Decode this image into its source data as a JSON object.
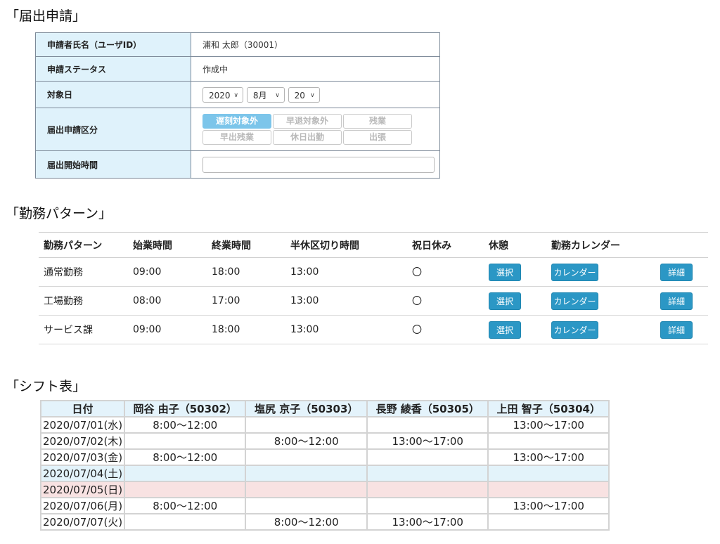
{
  "sections": {
    "form_title": "「届出申請」",
    "pattern_title": "「勤務パターン」",
    "shift_title": "「シフト表」"
  },
  "form": {
    "rows": [
      {
        "label": "申請者氏名（ユーザID）",
        "value": "浦和 太郎（30001）"
      },
      {
        "label": "申請ステータス",
        "value": "作成中"
      },
      {
        "label": "対象日"
      },
      {
        "label": "届出申請区分"
      },
      {
        "label": "届出開始時間"
      }
    ],
    "date": {
      "year": "2020",
      "month": "8月",
      "day": "20"
    },
    "category_buttons": [
      "遅刻対象外",
      "早退対象外",
      "残業",
      "早出残業",
      "休日出勤",
      "出張"
    ],
    "active_category_index": 0,
    "start_time_value": ""
  },
  "pattern": {
    "headers": [
      "勤務パターン",
      "始業時間",
      "終業時間",
      "半休区切り時間",
      "祝日休み",
      "休憩",
      "勤務カレンダー",
      ""
    ],
    "rows": [
      {
        "name": "通常勤務",
        "start": "09:00",
        "end": "18:00",
        "half": "13:00",
        "holiday": "〇"
      },
      {
        "name": "工場勤務",
        "start": "08:00",
        "end": "17:00",
        "half": "13:00",
        "holiday": "〇"
      },
      {
        "name": "サービス課",
        "start": "09:00",
        "end": "18:00",
        "half": "13:00",
        "holiday": "〇"
      }
    ],
    "select_label": "選択",
    "calendar_label": "カレンダー",
    "detail_label": "詳細"
  },
  "shift": {
    "headers": [
      "日付",
      "岡谷 由子（50302）",
      "塩尻 京子（50303）",
      "長野 綾香（50305）",
      "上田 智子（50304）"
    ],
    "rows": [
      {
        "date": "2020/07/01(水)",
        "day_type": "weekday",
        "cells": [
          "8:00～12:00",
          "",
          "",
          "13:00～17:00"
        ]
      },
      {
        "date": "2020/07/02(木)",
        "day_type": "weekday",
        "cells": [
          "",
          "8:00～12:00",
          "13:00～17:00",
          ""
        ]
      },
      {
        "date": "2020/07/03(金)",
        "day_type": "weekday",
        "cells": [
          "8:00～12:00",
          "",
          "",
          "13:00～17:00"
        ]
      },
      {
        "date": "2020/07/04(土)",
        "day_type": "saturday",
        "cells": [
          "",
          "",
          "",
          ""
        ]
      },
      {
        "date": "2020/07/05(日)",
        "day_type": "sunday",
        "cells": [
          "",
          "",
          "",
          ""
        ]
      },
      {
        "date": "2020/07/06(月)",
        "day_type": "weekday",
        "cells": [
          "8:00～12:00",
          "",
          "",
          "13:00～17:00"
        ]
      },
      {
        "date": "2020/07/07(火)",
        "day_type": "weekday",
        "cells": [
          "",
          "8:00～12:00",
          "13:00～17:00",
          ""
        ]
      }
    ]
  },
  "colors": {
    "label_bg": "#dff2fb",
    "active_button": "#7cc5ea",
    "action_button": "#2b97c5",
    "saturday_bg": "#e3f3fa",
    "sunday_bg": "#f8e2e2",
    "shift_header_bg": "#e4f3fb"
  },
  "icons": {
    "select_chevron": "chevron-down-icon"
  }
}
